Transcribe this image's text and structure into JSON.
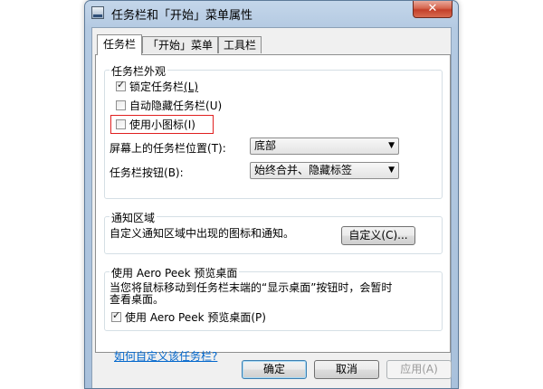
{
  "window": {
    "title": "任务栏和「开始」菜单属性",
    "close_symbol": "✕",
    "icon_name": "taskbar-app-icon"
  },
  "tabs": [
    {
      "label": "任务栏",
      "active": true
    },
    {
      "label": "「开始」菜单",
      "active": false
    },
    {
      "label": "工具栏",
      "active": false
    }
  ],
  "appearance": {
    "title": "任务栏外观",
    "lock_taskbar": {
      "label": "锁定任务栏",
      "accel": "(L)",
      "checked": true
    },
    "auto_hide": {
      "label": "自动隐藏任务栏",
      "accel": "(U)",
      "checked": false
    },
    "small_icons": {
      "label": "使用小图标",
      "accel": "(I)",
      "checked": false
    },
    "location_label": "屏幕上的任务栏位置",
    "location_accel": "(T):",
    "location_value": "底部",
    "buttons_label": "任务栏按钮",
    "buttons_accel": "(B):",
    "buttons_value": "始终合并、隐藏标签"
  },
  "notification": {
    "title": "通知区域",
    "desc": "自定义通知区域中出现的图标和通知。",
    "customize_button": "自定义(C)..."
  },
  "aero_peek": {
    "title": "使用 Aero Peek 预览桌面",
    "desc_line1": "当您将鼠标移动到任务栏末端的“显示桌面”按钮时，会暂时",
    "desc_line2": "查看桌面。",
    "checkbox_label": "使用 Aero Peek 预览桌面",
    "checkbox_accel": "(P)",
    "checked": true
  },
  "help_link": "如何自定义该任务栏?",
  "footer": {
    "ok": "确定",
    "cancel": "取消",
    "apply": "应用(A)"
  },
  "colors": {
    "highlight_box": "#e02020",
    "link": "#0066cc",
    "title_bar": "#b4cae2",
    "close_button": "#c3402a"
  }
}
